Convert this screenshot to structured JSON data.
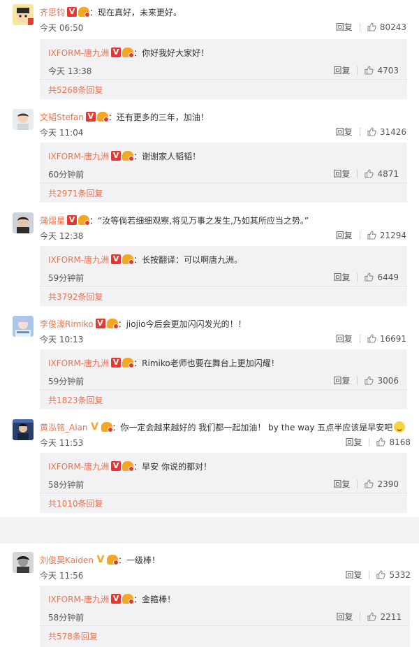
{
  "colors": {
    "username": "#eb7350",
    "reply_bg": "#f2f2f5",
    "verified": "#e8372f",
    "gold": "#f5a623"
  },
  "icons": {
    "like": "thumbs-up-icon",
    "verified": "v-badge-icon",
    "fan": "fan-crown-icon"
  },
  "reply_label": "回复",
  "comments": [
    {
      "user": "齐思钧",
      "text": "现在真好，未来更好。",
      "time": "今天 06:50",
      "likes": "80243",
      "reply": {
        "user": "IXFORM-唐九洲",
        "text": "你好我好大家好！",
        "time": "今天 13:38",
        "likes": "4703"
      },
      "reply_total": "共5268条回复"
    },
    {
      "user": "文韬Stefan",
      "text": "还有更多的三年，加油！",
      "time": "今天 11:04",
      "likes": "31426",
      "reply": {
        "user": "IXFORM-唐九洲",
        "text": "谢谢家人韬韬！",
        "time": "60分钟前",
        "likes": "4871"
      },
      "reply_total": "共2971条回复"
    },
    {
      "user": "蒲熠星",
      "text": "“汝等倘若细细观察,将见万事之发生,乃如其所应当之势。”",
      "time": "今天 12:38",
      "likes": "21294",
      "reply": {
        "user": "IXFORM-唐九洲",
        "text": "长按翻译：可以啊唐九洲。",
        "time": "59分钟前",
        "likes": "6449"
      },
      "reply_total": "共3792条回复"
    },
    {
      "user": "李俊濠Rimiko",
      "text": "jiojio今后会更加闪闪发光的！！",
      "time": "今天 10:13",
      "likes": "16691",
      "reply": {
        "user": "IXFORM-唐九洲",
        "text": "Rimiko老师也要在舞台上更加闪耀！",
        "time": "59分钟前",
        "likes": "3006"
      },
      "reply_total": "共1823条回复"
    },
    {
      "user": "黄泓铭_Alan",
      "text": "你一定会越来越好的 我们都一起加油！ by the way 五点半应该是早安吧",
      "time": "今天 11:53",
      "likes": "8168",
      "reply": {
        "user": "IXFORM-唐九洲",
        "text": "早安 你说的都对！",
        "time": "58分钟前",
        "likes": "2390"
      },
      "reply_total": "共1010条回复"
    },
    {
      "user": "刘俊昊Kaiden",
      "text": "一级棒！",
      "time": "今天 11:56",
      "likes": "5332",
      "reply": {
        "user": "IXFORM-唐九洲",
        "text": "金箍棒！",
        "time": "58分钟前",
        "likes": "2211"
      },
      "reply_total": "共578条回复"
    }
  ]
}
